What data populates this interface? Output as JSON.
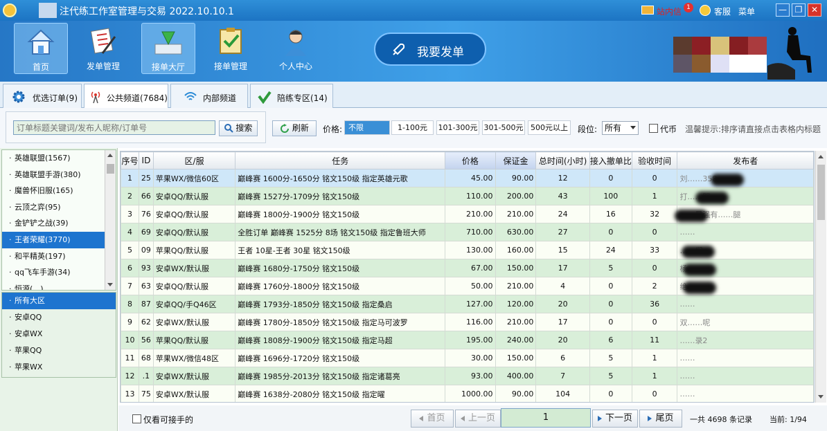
{
  "window": {
    "title": "注代练工作室管理与交易 2022.10.10.1",
    "message_label": "站内信",
    "message_count": "1",
    "service_label": "客服",
    "menu_label": "菜单",
    "min": "—",
    "restore": "❐",
    "close": "✕"
  },
  "toolbar": {
    "items": [
      {
        "label": "首页"
      },
      {
        "label": "发单管理"
      },
      {
        "label": "接单大厅"
      },
      {
        "label": "接单管理"
      },
      {
        "label": "个人中心"
      }
    ],
    "publish_label": "我要发单"
  },
  "tabs": [
    {
      "label": "优选订单(9)"
    },
    {
      "label": "公共频道(7684)"
    },
    {
      "label": "内部频道"
    },
    {
      "label": "陪练专区(14)"
    }
  ],
  "filter": {
    "search_placeholder": "订单标题关键词/发布人昵称/订单号",
    "search_label": "搜索",
    "refresh_label": "刷新",
    "price_label": "价格:",
    "price_options": [
      "不限",
      "1-100元",
      "101-300元",
      "301-500元",
      "500元以上"
    ],
    "rank_label": "段位:",
    "rank_value": "所有",
    "proxy_label": "代币",
    "hint": "温馨提示:排序请直接点击表格内标题"
  },
  "games": [
    "英雄联盟(1567)",
    "英雄联盟手游(380)",
    "魔兽怀旧服(165)",
    "云顶之弈(95)",
    "金铲铲之战(39)",
    "王者荣耀(3770)",
    "和平精英(197)",
    "qq飞车手游(34)",
    "恒源(…)"
  ],
  "regions": [
    "所有大区",
    "安卓QQ",
    "安卓WX",
    "苹果QQ",
    "苹果WX"
  ],
  "table": {
    "headers": [
      "序号",
      "ID",
      "区/服",
      "任务",
      "价格",
      "保证金",
      "总时间(小时)",
      "接入撤单比",
      "验收时间",
      "发布者"
    ],
    "rows": [
      {
        "no": "1",
        "id": "25",
        "server": "苹果WX/微信60区",
        "task": "巅峰赛 1600分-1650分 铭文150级 指定英雄元歌",
        "price": "45.00",
        "deposit": "90.00",
        "hours": "12",
        "ratio": "0",
        "accept": "0",
        "publisher": "刘……358"
      },
      {
        "no": "2",
        "id": "66",
        "server": "安卓QQ/默认服",
        "task": "巅峰赛 1527分-1709分 铭文150级",
        "price": "110.00",
        "deposit": "200.00",
        "hours": "43",
        "ratio": "100",
        "accept": "1",
        "publisher": "打……闘"
      },
      {
        "no": "3",
        "id": "76",
        "server": "安卓QQ/默认服",
        "task": "巅峰赛 1800分-1900分 铭文150级",
        "price": "210.00",
        "deposit": "210.00",
        "hours": "24",
        "ratio": "16",
        "accept": "32",
        "publisher": "……最强有……腿"
      },
      {
        "no": "4",
        "id": "69",
        "server": "安卓QQ/默认服",
        "task": "全胜订单 巅峰赛 1525分 8场 铭文150级 指定鲁班大师",
        "price": "710.00",
        "deposit": "630.00",
        "hours": "27",
        "ratio": "0",
        "accept": "0",
        "publisher": "……"
      },
      {
        "no": "5",
        "id": "09",
        "server": "苹果QQ/默认服",
        "task": "王者 10星-王者 30星 铭文150级",
        "price": "130.00",
        "deposit": "160.00",
        "hours": "15",
        "ratio": "24",
        "accept": "33",
        "publisher": "……们"
      },
      {
        "no": "6",
        "id": "93",
        "server": "安卓WX/默认服",
        "task": "巅峰赛 1680分-1750分 铭文150级",
        "price": "67.00",
        "deposit": "150.00",
        "hours": "17",
        "ratio": "5",
        "accept": "0",
        "publisher": "杨……"
      },
      {
        "no": "7",
        "id": "63",
        "server": "安卓QQ/默认服",
        "task": "巅峰赛 1760分-1800分 铭文150级",
        "price": "50.00",
        "deposit": "210.00",
        "hours": "4",
        "ratio": "0",
        "accept": "2",
        "publisher": "绝……"
      },
      {
        "no": "8",
        "id": "87",
        "server": "安卓QQ/手Q46区",
        "task": "巅峰赛 1793分-1850分 铭文150级 指定桑启",
        "price": "127.00",
        "deposit": "120.00",
        "hours": "20",
        "ratio": "0",
        "accept": "36",
        "publisher": "……"
      },
      {
        "no": "9",
        "id": "62",
        "server": "安卓WX/默认服",
        "task": "巅峰赛 1780分-1850分 铭文150级 指定马可波罗",
        "price": "116.00",
        "deposit": "210.00",
        "hours": "17",
        "ratio": "0",
        "accept": "0",
        "publisher": "双……呢"
      },
      {
        "no": "10",
        "id": "56",
        "server": "苹果QQ/默认服",
        "task": "巅峰赛 1808分-1900分 铭文150级 指定马超",
        "price": "195.00",
        "deposit": "240.00",
        "hours": "20",
        "ratio": "6",
        "accept": "11",
        "publisher": "……录2"
      },
      {
        "no": "11",
        "id": "68",
        "server": "苹果WX/微信48区",
        "task": "巅峰赛 1696分-1720分 铭文150级",
        "price": "30.00",
        "deposit": "150.00",
        "hours": "6",
        "ratio": "5",
        "accept": "1",
        "publisher": "……"
      },
      {
        "no": "12",
        "id": ".1",
        "server": "安卓WX/默认服",
        "task": "巅峰赛 1985分-2013分 铭文150级  指定诸葛亮",
        "price": "93.00",
        "deposit": "400.00",
        "hours": "7",
        "ratio": "5",
        "accept": "1",
        "publisher": "……"
      },
      {
        "no": "13",
        "id": "75",
        "server": "安卓WX/默认服",
        "task": "巅峰赛 1638分-2080分 铭文150级 指定曜",
        "price": "1000.00",
        "deposit": "90.00",
        "hours": "104",
        "ratio": "0",
        "accept": "0",
        "publisher": "……"
      }
    ]
  },
  "footer": {
    "only_accept_label": "仅看可接手的",
    "first": "首页",
    "prev": "上一页",
    "page_input": "1",
    "next": "下一页",
    "last": "尾页",
    "total": "一共 4698 条记录",
    "current": "当前: 1/94"
  }
}
